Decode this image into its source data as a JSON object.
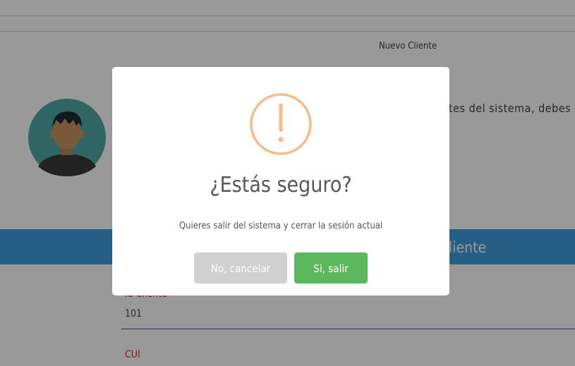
{
  "breadcrumb": {
    "current": "Nuevo Cliente"
  },
  "intro": {
    "text_fragment": "tes del sistema, debes de"
  },
  "banner": {
    "title_fragment": "liente"
  },
  "form": {
    "id_label": "Id Cliente",
    "id_value": "101",
    "cui_label": "CUI"
  },
  "dialog": {
    "icon": "exclamation-warning-icon",
    "title": "¿Estás seguro?",
    "text": "Quieres salir del sistema y cerrar la sesión actual",
    "cancel_label": "No, cancelar",
    "confirm_label": "Si, salir"
  },
  "colors": {
    "overlay": "rgba(0,0,0,0.4)",
    "banner": "#3f9fdb",
    "warning": "#f8bb86",
    "confirm": "#5cb85c",
    "cancel": "#d0d0d0",
    "label_red": "#c0392b"
  }
}
